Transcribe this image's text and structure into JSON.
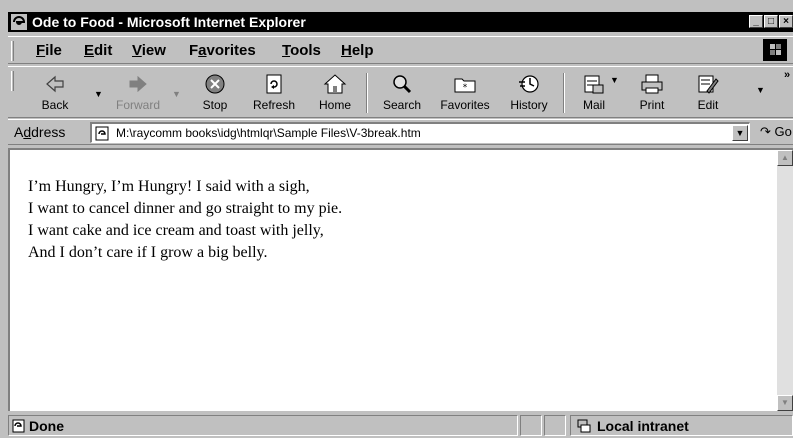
{
  "window": {
    "title": "Ode to Food - Microsoft Internet Explorer",
    "controls": {
      "minimize": "_",
      "maximize": "□",
      "close": "×"
    }
  },
  "menubar": {
    "items": [
      {
        "label": "File",
        "access": "F",
        "rest": "ile"
      },
      {
        "label": "Edit",
        "access": "E",
        "rest": "dit"
      },
      {
        "label": "View",
        "access": "V",
        "rest": "iew"
      },
      {
        "label": "Favorites",
        "pre": "F",
        "access": "a",
        "rest": "vorites"
      },
      {
        "label": "Tools",
        "access": "T",
        "rest": "ools"
      },
      {
        "label": "Help",
        "access": "H",
        "rest": "elp"
      }
    ]
  },
  "toolbar": {
    "back": "Back",
    "forward": "Forward",
    "stop": "Stop",
    "refresh": "Refresh",
    "home": "Home",
    "search": "Search",
    "favorites": "Favorites",
    "history": "History",
    "mail": "Mail",
    "print": "Print",
    "edit": "Edit"
  },
  "addressbar": {
    "label_pre": "A",
    "label_access": "d",
    "label_rest": "dress",
    "url": "M:\\raycomm books\\idg\\htmlqr\\Sample Files\\V-3break.htm",
    "go": "Go"
  },
  "content": {
    "lines": [
      "I’m Hungry, I’m Hungry! I said with a sigh,",
      "I want to cancel dinner and go straight to my pie.",
      "I want cake and ice cream and toast with jelly,",
      "And I don’t care if I grow a big belly."
    ]
  },
  "statusbar": {
    "status": "Done",
    "zone": "Local intranet"
  },
  "colors": {
    "chrome": "#c0c0c0",
    "titlebar": "#000000",
    "page": "#ffffff"
  }
}
